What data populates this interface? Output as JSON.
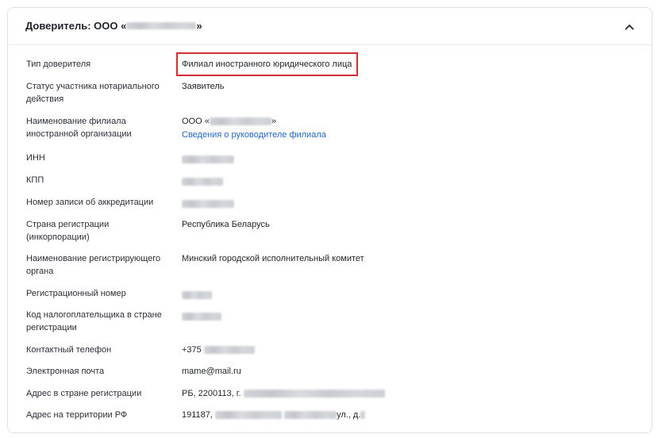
{
  "header": {
    "title_prefix": "Доверитель: ООО «",
    "title_suffix": "»",
    "collapse_icon": "chevron-up-icon"
  },
  "rows": [
    {
      "label": "Тип доверителя",
      "value": "Филиал иностранного юридического лица"
    },
    {
      "label": "Статус участника нотариального действия",
      "value": "Заявитель"
    },
    {
      "label": "Наименование филиала иностранной организации",
      "value_prefix": "ООО «",
      "value_suffix": "»",
      "link": "Сведения о руководителе филиала"
    },
    {
      "label": "ИНН"
    },
    {
      "label": "КПП"
    },
    {
      "label": "Номер записи об аккредитации"
    },
    {
      "label": "Страна регистрации (инкорпорации)",
      "value": "Республика Беларусь"
    },
    {
      "label": "Наименование регистрирующего органа",
      "value": "Минский городской исполнительный комитет"
    },
    {
      "label": "Регистрационный номер"
    },
    {
      "label": "Код налогоплательщика в стране регистрации"
    },
    {
      "label": "Контактный телефон",
      "value": "+375"
    },
    {
      "label": "Электронная почта",
      "value": "mame@mail.ru"
    },
    {
      "label": "Адрес в стране регистрации",
      "value": "РБ, 2200113, г."
    },
    {
      "label": "Адрес на территории РФ",
      "value_prefix": "191187,",
      "value_middle": "ул., д."
    }
  ],
  "colors": {
    "highlight_border": "#d22f35",
    "link": "#2467c9"
  }
}
